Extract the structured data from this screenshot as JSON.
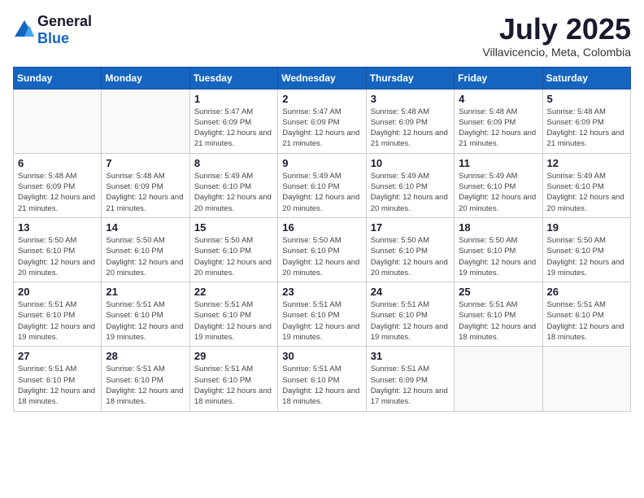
{
  "logo": {
    "general": "General",
    "blue": "Blue"
  },
  "header": {
    "month_year": "July 2025",
    "location": "Villavicencio, Meta, Colombia"
  },
  "weekdays": [
    "Sunday",
    "Monday",
    "Tuesday",
    "Wednesday",
    "Thursday",
    "Friday",
    "Saturday"
  ],
  "weeks": [
    [
      {
        "day": "",
        "info": ""
      },
      {
        "day": "",
        "info": ""
      },
      {
        "day": "1",
        "info": "Sunrise: 5:47 AM\nSunset: 6:09 PM\nDaylight: 12 hours and 21 minutes."
      },
      {
        "day": "2",
        "info": "Sunrise: 5:47 AM\nSunset: 6:09 PM\nDaylight: 12 hours and 21 minutes."
      },
      {
        "day": "3",
        "info": "Sunrise: 5:48 AM\nSunset: 6:09 PM\nDaylight: 12 hours and 21 minutes."
      },
      {
        "day": "4",
        "info": "Sunrise: 5:48 AM\nSunset: 6:09 PM\nDaylight: 12 hours and 21 minutes."
      },
      {
        "day": "5",
        "info": "Sunrise: 5:48 AM\nSunset: 6:09 PM\nDaylight: 12 hours and 21 minutes."
      }
    ],
    [
      {
        "day": "6",
        "info": "Sunrise: 5:48 AM\nSunset: 6:09 PM\nDaylight: 12 hours and 21 minutes."
      },
      {
        "day": "7",
        "info": "Sunrise: 5:48 AM\nSunset: 6:09 PM\nDaylight: 12 hours and 21 minutes."
      },
      {
        "day": "8",
        "info": "Sunrise: 5:49 AM\nSunset: 6:10 PM\nDaylight: 12 hours and 20 minutes."
      },
      {
        "day": "9",
        "info": "Sunrise: 5:49 AM\nSunset: 6:10 PM\nDaylight: 12 hours and 20 minutes."
      },
      {
        "day": "10",
        "info": "Sunrise: 5:49 AM\nSunset: 6:10 PM\nDaylight: 12 hours and 20 minutes."
      },
      {
        "day": "11",
        "info": "Sunrise: 5:49 AM\nSunset: 6:10 PM\nDaylight: 12 hours and 20 minutes."
      },
      {
        "day": "12",
        "info": "Sunrise: 5:49 AM\nSunset: 6:10 PM\nDaylight: 12 hours and 20 minutes."
      }
    ],
    [
      {
        "day": "13",
        "info": "Sunrise: 5:50 AM\nSunset: 6:10 PM\nDaylight: 12 hours and 20 minutes."
      },
      {
        "day": "14",
        "info": "Sunrise: 5:50 AM\nSunset: 6:10 PM\nDaylight: 12 hours and 20 minutes."
      },
      {
        "day": "15",
        "info": "Sunrise: 5:50 AM\nSunset: 6:10 PM\nDaylight: 12 hours and 20 minutes."
      },
      {
        "day": "16",
        "info": "Sunrise: 5:50 AM\nSunset: 6:10 PM\nDaylight: 12 hours and 20 minutes."
      },
      {
        "day": "17",
        "info": "Sunrise: 5:50 AM\nSunset: 6:10 PM\nDaylight: 12 hours and 20 minutes."
      },
      {
        "day": "18",
        "info": "Sunrise: 5:50 AM\nSunset: 6:10 PM\nDaylight: 12 hours and 19 minutes."
      },
      {
        "day": "19",
        "info": "Sunrise: 5:50 AM\nSunset: 6:10 PM\nDaylight: 12 hours and 19 minutes."
      }
    ],
    [
      {
        "day": "20",
        "info": "Sunrise: 5:51 AM\nSunset: 6:10 PM\nDaylight: 12 hours and 19 minutes."
      },
      {
        "day": "21",
        "info": "Sunrise: 5:51 AM\nSunset: 6:10 PM\nDaylight: 12 hours and 19 minutes."
      },
      {
        "day": "22",
        "info": "Sunrise: 5:51 AM\nSunset: 6:10 PM\nDaylight: 12 hours and 19 minutes."
      },
      {
        "day": "23",
        "info": "Sunrise: 5:51 AM\nSunset: 6:10 PM\nDaylight: 12 hours and 19 minutes."
      },
      {
        "day": "24",
        "info": "Sunrise: 5:51 AM\nSunset: 6:10 PM\nDaylight: 12 hours and 19 minutes."
      },
      {
        "day": "25",
        "info": "Sunrise: 5:51 AM\nSunset: 6:10 PM\nDaylight: 12 hours and 18 minutes."
      },
      {
        "day": "26",
        "info": "Sunrise: 5:51 AM\nSunset: 6:10 PM\nDaylight: 12 hours and 18 minutes."
      }
    ],
    [
      {
        "day": "27",
        "info": "Sunrise: 5:51 AM\nSunset: 6:10 PM\nDaylight: 12 hours and 18 minutes."
      },
      {
        "day": "28",
        "info": "Sunrise: 5:51 AM\nSunset: 6:10 PM\nDaylight: 12 hours and 18 minutes."
      },
      {
        "day": "29",
        "info": "Sunrise: 5:51 AM\nSunset: 6:10 PM\nDaylight: 12 hours and 18 minutes."
      },
      {
        "day": "30",
        "info": "Sunrise: 5:51 AM\nSunset: 6:10 PM\nDaylight: 12 hours and 18 minutes."
      },
      {
        "day": "31",
        "info": "Sunrise: 5:51 AM\nSunset: 6:09 PM\nDaylight: 12 hours and 17 minutes."
      },
      {
        "day": "",
        "info": ""
      },
      {
        "day": "",
        "info": ""
      }
    ]
  ]
}
